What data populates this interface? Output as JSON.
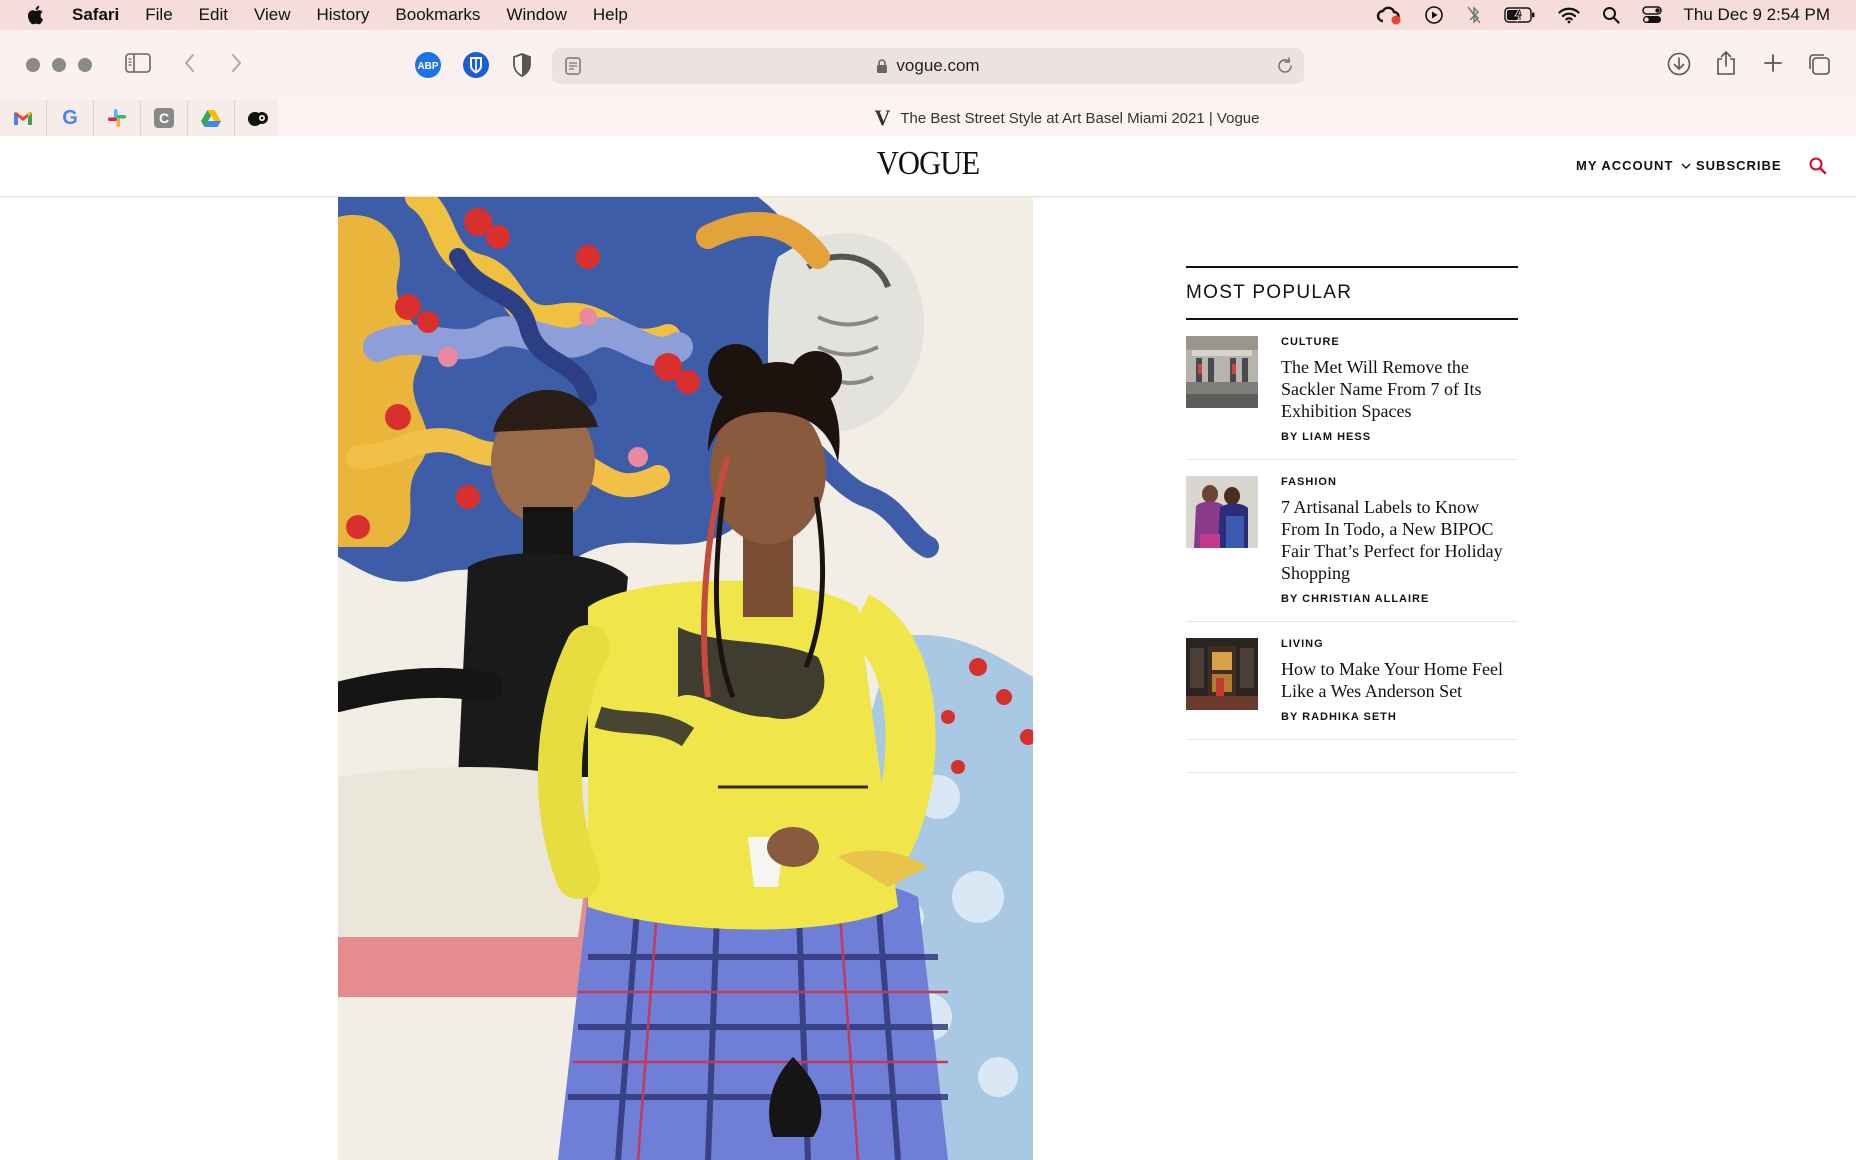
{
  "menubar": {
    "app_name": "Safari",
    "items": [
      "File",
      "Edit",
      "View",
      "History",
      "Bookmarks",
      "Window",
      "Help"
    ],
    "clock": "Thu Dec 9  2:54 PM"
  },
  "browser": {
    "url": "vogue.com",
    "extensions": [
      {
        "name": "adblock-plus-icon",
        "label": "ABP"
      },
      {
        "name": "bitwarden-icon",
        "label": ""
      },
      {
        "name": "privacy-shield-icon",
        "label": ""
      }
    ],
    "pinned_tabs": [
      "gmail-icon",
      "google-icon",
      "slack-icon",
      "c-app-icon",
      "google-drive-icon",
      "ai-assistant-icon"
    ],
    "pinned_labels": {
      "google": "G",
      "c_app": "C"
    },
    "active_tab_title": "The Best Street Style at Art Basel Miami 2021 | Vogue",
    "active_tab_favicon": "V"
  },
  "site": {
    "logo": "VOGUE",
    "account_label": "MY ACCOUNT",
    "subscribe_label": "SUBSCRIBE",
    "accent_color": "#c8102e"
  },
  "most_popular": {
    "heading": "MOST POPULAR",
    "articles": [
      {
        "category": "CULTURE",
        "headline": "The Met Will Remove the Sackler Name From 7 of Its Exhibition Spaces",
        "byline": "BY LIAM HESS"
      },
      {
        "category": "FASHION",
        "headline": "7 Artisanal Labels to Know From In Todo, a New BIPOC Fair That’s Perfect for Holiday Shopping",
        "byline": "BY CHRISTIAN ALLAIRE"
      },
      {
        "category": "LIVING",
        "headline": "How to Make Your Home Feel Like a Wes Anderson Set",
        "byline": "BY RADHIKA SETH"
      }
    ]
  }
}
